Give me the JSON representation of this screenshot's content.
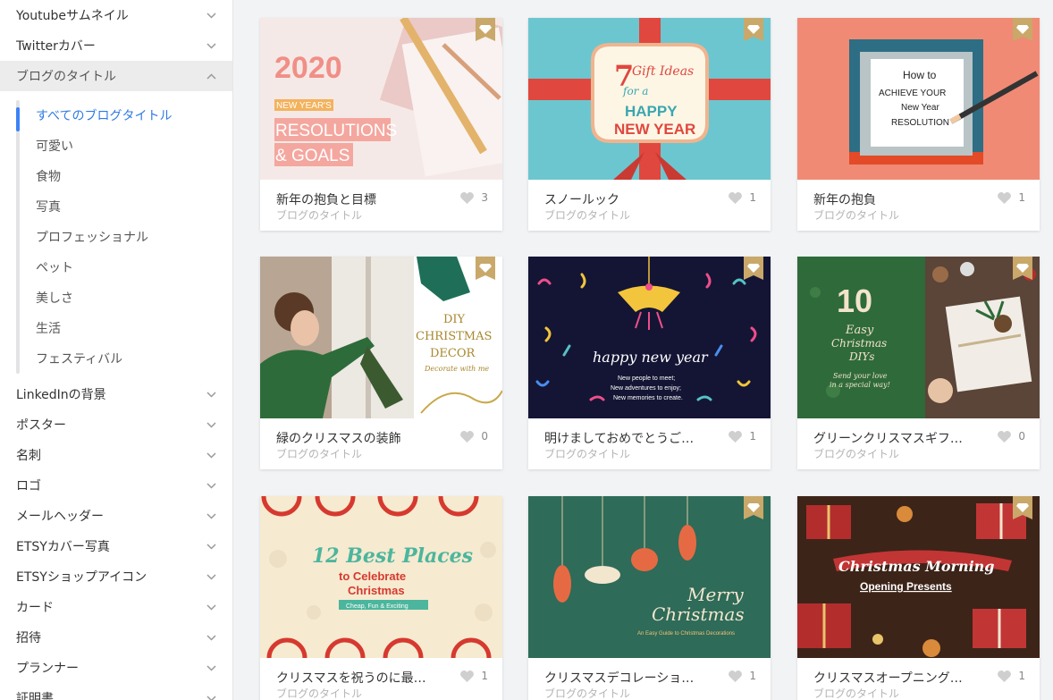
{
  "sidebar": {
    "top_categories": [
      "Youtubeサムネイル",
      "Twitterカバー"
    ],
    "active_category": "ブログのタイトル",
    "subcategories": [
      "すべてのブログタイトル",
      "可愛い",
      "食物",
      "写真",
      "プロフェッショナル",
      "ペット",
      "美しさ",
      "生活",
      "フェスティバル"
    ],
    "categories": [
      "LinkedInの背景",
      "ポスター",
      "名刺",
      "ロゴ",
      "メールヘッダー",
      "ETSYカバー写真",
      "ETSYショップアイコン",
      "カード",
      "招待",
      "プランナー",
      "証明書"
    ]
  },
  "cards": [
    {
      "title": "新年の抱負と目標",
      "subtitle": "ブログのタイトル",
      "likes": "3",
      "thumb": {
        "big": "2020",
        "small": "NEW YEAR'S",
        "line1": "RESOLUTIONS",
        "line2": "& GOALS"
      }
    },
    {
      "title": "スノールック",
      "subtitle": "ブログのタイトル",
      "likes": "1",
      "thumb": {
        "num": "7",
        "line1": "Gift Ideas",
        "line2": "for a",
        "line3": "HAPPY",
        "line4": "NEW YEAR"
      }
    },
    {
      "title": "新年の抱負",
      "subtitle": "ブログのタイトル",
      "likes": "1",
      "thumb": {
        "line1": "How to",
        "line2": "ACHIEVE YOUR",
        "line3": "New Year",
        "line4": "RESOLUTION"
      }
    },
    {
      "title": "緑のクリスマスの装飾",
      "subtitle": "ブログのタイトル",
      "likes": "0",
      "thumb": {
        "line1": "DIY",
        "line2": "CHRISTMAS",
        "line3": "DECOR",
        "line4": "Decorate with me"
      }
    },
    {
      "title": "明けましておめでとうご…",
      "subtitle": "ブログのタイトル",
      "likes": "1",
      "thumb": {
        "line1": "happy new year",
        "line2": "New people to meet;",
        "line3": "New adventures to enjoy;",
        "line4": "New memories to create."
      }
    },
    {
      "title": "グリーンクリスマスギフ…",
      "subtitle": "ブログのタイトル",
      "likes": "0",
      "thumb": {
        "num": "10",
        "line1": "Easy",
        "line2": "Christmas",
        "line3": "DIYs",
        "line4": "Send your love",
        "line5": "in a special way!"
      }
    },
    {
      "title": "クリスマスを祝うのに最…",
      "subtitle": "ブログのタイトル",
      "likes": "1",
      "thumb": {
        "line1": "12 Best Places",
        "line2": "to Celebrate",
        "line3": "Christmas",
        "line4": "Cheap, Fun & Exciting"
      }
    },
    {
      "title": "クリスマスデコレーショ…",
      "subtitle": "ブログのタイトル",
      "likes": "1",
      "thumb": {
        "line1": "Merry",
        "line2": "Christmas",
        "line3": "An Easy Guide to Christmas Decorations"
      }
    },
    {
      "title": "クリスマスオープニング…",
      "subtitle": "ブログのタイトル",
      "likes": "1",
      "thumb": {
        "line1": "Christmas Morning",
        "line2": "Opening Presents"
      }
    }
  ],
  "icons": {
    "chevron": "chevron-down-icon",
    "chevron_up": "chevron-up-icon",
    "heart": "heart-icon",
    "premium": "diamond-crown-icon"
  },
  "colors": {
    "accent": "#2f7ae5",
    "premium_badge": "#c9a86a"
  }
}
